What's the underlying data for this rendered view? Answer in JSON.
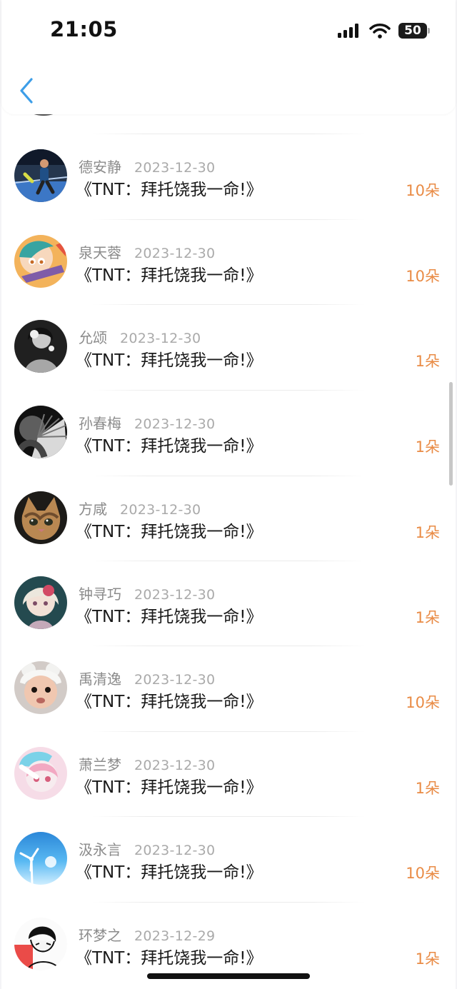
{
  "status_bar": {
    "time": "21:05",
    "battery": "50",
    "icons": [
      "cellular-signal-icon",
      "wifi-icon",
      "battery-icon"
    ]
  },
  "header": {
    "back_icon": "chevron-left-icon"
  },
  "colors": {
    "back_arrow": "#3d9ee8",
    "gift_amount": "#e98b45",
    "name": "#8b8b8b",
    "date": "#aaaaaa",
    "title": "#1a1a1a"
  },
  "gift_list": [
    {
      "name": "德安静",
      "date": "2023-12-30",
      "title": "《TNT：拜托饶我一命!》",
      "amount": "10朵",
      "avatar": "runner-photo-avatar"
    },
    {
      "name": "泉天蓉",
      "date": "2023-12-30",
      "title": "《TNT：拜托饶我一命!》",
      "amount": "10朵",
      "avatar": "anime-girl-avatar"
    },
    {
      "name": "允颂",
      "date": "2023-12-30",
      "title": "《TNT：拜托饶我一命!》",
      "amount": "1朵",
      "avatar": "grayscale-portrait-avatar"
    },
    {
      "name": "孙春梅",
      "date": "2023-12-30",
      "title": "《TNT：拜托饶我一命!》",
      "amount": "1朵",
      "avatar": "fan-portrait-avatar"
    },
    {
      "name": "方咸",
      "date": "2023-12-30",
      "title": "《TNT：拜托饶我一命!》",
      "amount": "1朵",
      "avatar": "cat-avatar"
    },
    {
      "name": "钟寻巧",
      "date": "2023-12-30",
      "title": "《TNT：拜托饶我一命!》",
      "amount": "1朵",
      "avatar": "anime-doll-avatar"
    },
    {
      "name": "禹清逸",
      "date": "2023-12-30",
      "title": "《TNT：拜托饶我一命!》",
      "amount": "10朵",
      "avatar": "baby-avatar"
    },
    {
      "name": "萧兰梦",
      "date": "2023-12-30",
      "title": "《TNT：拜托饶我一命!》",
      "amount": "1朵",
      "avatar": "pink-anime-avatar"
    },
    {
      "name": "汲永言",
      "date": "2023-12-30",
      "title": "《TNT：拜托饶我一命!》",
      "amount": "10朵",
      "avatar": "wind-turbine-avatar"
    },
    {
      "name": "环梦之",
      "date": "2023-12-29",
      "title": "《TNT：拜托饶我一命!》",
      "amount": "1朵",
      "avatar": "sketch-boy-avatar"
    }
  ]
}
